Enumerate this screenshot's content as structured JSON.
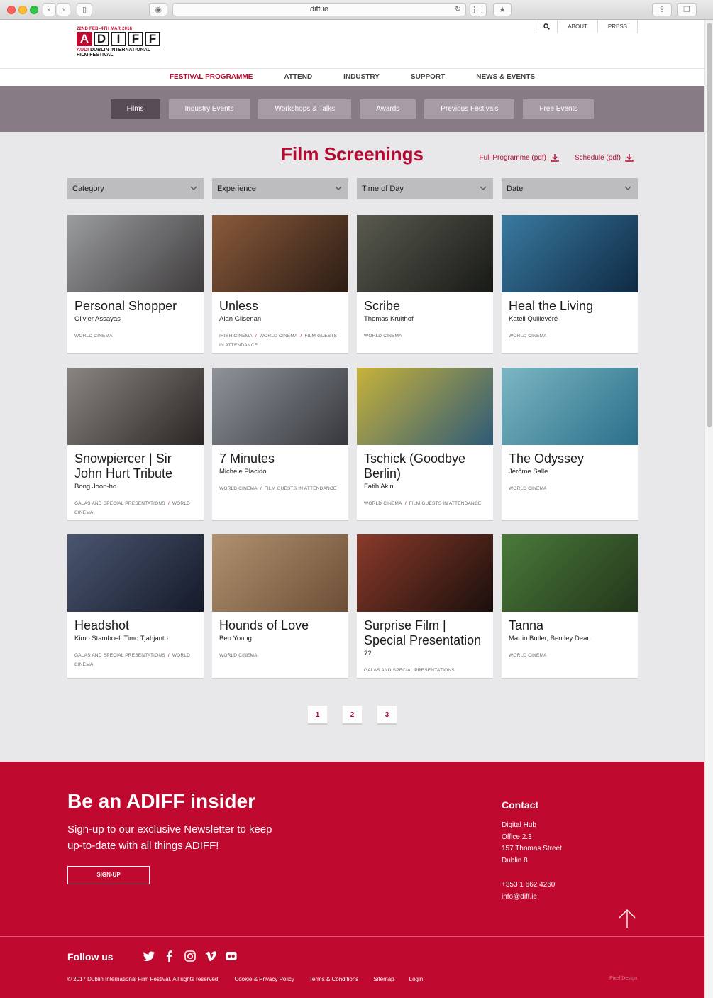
{
  "browser": {
    "url": "diff.ie"
  },
  "header": {
    "logo": {
      "dates": "22ND FEB–4TH MAR 2018",
      "letters": [
        "A",
        "D",
        "I",
        "F",
        "F"
      ],
      "line1_brand": "AUDI",
      "line1_rest": " DUBLIN INTERNATIONAL",
      "line2": "FILM FESTIVAL"
    },
    "utility": {
      "search_icon": "search-icon",
      "about": "ABOUT",
      "press": "PRESS"
    }
  },
  "main_nav": [
    {
      "label": "FESTIVAL PROGRAMME",
      "active": true
    },
    {
      "label": "ATTEND",
      "active": false
    },
    {
      "label": "INDUSTRY",
      "active": false
    },
    {
      "label": "SUPPORT",
      "active": false
    },
    {
      "label": "NEWS & EVENTS",
      "active": false
    }
  ],
  "sub_nav": [
    {
      "label": "Films",
      "active": true
    },
    {
      "label": "Industry Events",
      "active": false
    },
    {
      "label": "Workshops & Talks",
      "active": false
    },
    {
      "label": "Awards",
      "active": false
    },
    {
      "label": "Previous Festivals",
      "active": false
    },
    {
      "label": "Free Events",
      "active": false
    }
  ],
  "page": {
    "title": "Film Screenings",
    "pdf_links": [
      {
        "label": "Full Programme (pdf)",
        "icon": "download-icon"
      },
      {
        "label": "Schedule (pdf)",
        "icon": "download-icon"
      }
    ],
    "filters": [
      "Category",
      "Experience",
      "Time of Day",
      "Date"
    ]
  },
  "films": [
    {
      "title": "Personal Shopper",
      "director": "Olivier Assayas",
      "tags": [
        "WORLD CINEMA"
      ],
      "colors": [
        "#9a9c9f",
        "#3f3c3d"
      ]
    },
    {
      "title": "Unless",
      "director": "Alan Gilsenan",
      "tags": [
        "IRISH CINEMA",
        "WORLD CINEMA",
        "FILM GUESTS IN ATTENDANCE"
      ],
      "colors": [
        "#8a5a3a",
        "#2b1c15"
      ]
    },
    {
      "title": "Scribe",
      "director": "Thomas Kruithof",
      "tags": [
        "WORLD CINEMA"
      ],
      "colors": [
        "#5a5a50",
        "#181a16"
      ]
    },
    {
      "title": "Heal the Living",
      "director": "Katell Quillévéré",
      "tags": [
        "WORLD CINEMA"
      ],
      "colors": [
        "#3a7aa0",
        "#0e2a44"
      ]
    },
    {
      "title": "Snowpiercer | Sir John Hurt Tribute",
      "director": "Bong Joon-ho",
      "tags": [
        "GALAS AND SPECIAL PRESENTATIONS",
        "WORLD CINEMA"
      ],
      "colors": [
        "#8a8580",
        "#2a2624"
      ]
    },
    {
      "title": "7 Minutes",
      "director": "Michele Placido",
      "tags": [
        "WORLD CINEMA",
        "FILM GUESTS IN ATTENDANCE"
      ],
      "colors": [
        "#8f949a",
        "#35373c"
      ]
    },
    {
      "title": "Tschick (Goodbye Berlin)",
      "director": "Fatih Akin",
      "tags": [
        "WORLD CINEMA",
        "FILM GUESTS IN ATTENDANCE"
      ],
      "colors": [
        "#c7b23a",
        "#2e5a78"
      ]
    },
    {
      "title": "The Odyssey",
      "director": "Jérôme Salle",
      "tags": [
        "WORLD CINEMA"
      ],
      "colors": [
        "#7cb6c2",
        "#2a6f8a"
      ]
    },
    {
      "title": "Headshot",
      "director": "Kimo Stamboel, Timo Tjahjanto",
      "tags": [
        "GALAS AND SPECIAL PRESENTATIONS",
        "WORLD CINEMA"
      ],
      "colors": [
        "#4a5670",
        "#151a2a"
      ]
    },
    {
      "title": "Hounds of Love",
      "director": "Ben Young",
      "tags": [
        "WORLD CINEMA"
      ],
      "colors": [
        "#b09270",
        "#6c4e36"
      ]
    },
    {
      "title": "Surprise Film | Special Presentation",
      "director": "??",
      "tags": [
        "GALAS AND SPECIAL PRESENTATIONS"
      ],
      "colors": [
        "#8a3a2a",
        "#1a0f0c"
      ]
    },
    {
      "title": "Tanna",
      "director": "Martin Butler, Bentley Dean",
      "tags": [
        "WORLD CINEMA"
      ],
      "colors": [
        "#4a7a3a",
        "#23361b"
      ]
    }
  ],
  "pagination": [
    "1",
    "2",
    "3"
  ],
  "footer": {
    "heading": "Be an ADIFF insider",
    "text": "Sign-up to our exclusive Newsletter to keep up-to-date with all things ADIFF!",
    "signup": "SIGN-UP",
    "contact_heading": "Contact",
    "address": [
      "Digital Hub",
      "Office 2.3",
      "157 Thomas Street",
      "Dublin 8"
    ],
    "phone": "+353 1 662 4260",
    "email": "info@diff.ie",
    "follow": "Follow us",
    "social_icons": [
      "twitter-icon",
      "facebook-icon",
      "instagram-icon",
      "vimeo-icon",
      "flickr-icon"
    ],
    "bottom_links": [
      "© 2017 Dublin International Film Festival. All rights reserved.",
      "Cookie & Privacy Policy",
      "Terms & Conditions",
      "Sitemap",
      "Login"
    ],
    "credit": "Pixel Design"
  },
  "colors": {
    "brand_red": "#c0092f",
    "subnav_bg": "#877b86",
    "subnav_tab": "#a79ca6",
    "subnav_active": "#574b56",
    "content_bg": "#e8e8ea"
  }
}
